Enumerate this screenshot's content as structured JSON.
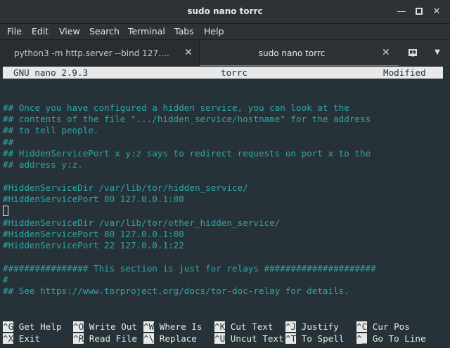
{
  "window": {
    "title": "sudo nano torrc",
    "minimize_icon": "minimize-icon",
    "maximize_icon": "maximize-icon",
    "close_icon": "close-icon"
  },
  "menu": [
    "File",
    "Edit",
    "View",
    "Search",
    "Terminal",
    "Tabs",
    "Help"
  ],
  "tabs": [
    {
      "label": "python3 -m http.server --bind 127.…",
      "active": false
    },
    {
      "label": "sudo nano torrc",
      "active": true
    }
  ],
  "nano": {
    "version": "GNU nano 2.9.3",
    "filename": "torrc",
    "status": "Modified"
  },
  "file_lines": [
    {
      "text": "## Once you have configured a hidden service, you can look at the",
      "type": "comment"
    },
    {
      "text": "## contents of the file \".../hidden_service/hostname\" for the address",
      "type": "comment"
    },
    {
      "text": "## to tell people.",
      "type": "comment"
    },
    {
      "text": "##",
      "type": "comment"
    },
    {
      "text": "## HiddenServicePort x y:z says to redirect requests on port x to the",
      "type": "comment"
    },
    {
      "text": "## address y:z.",
      "type": "comment"
    },
    {
      "text": "",
      "type": "blank"
    },
    {
      "text": "#HiddenServiceDir /var/lib/tor/hidden_service/",
      "type": "comment"
    },
    {
      "text": "#HiddenServicePort 80 127.0.0.1:80",
      "type": "comment"
    },
    {
      "text": "",
      "type": "cursor"
    },
    {
      "text": "#HiddenServiceDir /var/lib/tor/other_hidden_service/",
      "type": "comment"
    },
    {
      "text": "#HiddenServicePort 80 127.0.0.1:80",
      "type": "comment"
    },
    {
      "text": "#HiddenServicePort 22 127.0.0.1:22",
      "type": "comment"
    },
    {
      "text": "",
      "type": "blank"
    },
    {
      "text": "################ This section is just for relays #####################",
      "type": "comment"
    },
    {
      "text": "#",
      "type": "comment"
    },
    {
      "text": "## See https://www.torproject.org/docs/tor-doc-relay for details.",
      "type": "comment"
    }
  ],
  "shortcuts": [
    {
      "key": "^G",
      "label": "Get Help"
    },
    {
      "key": "^O",
      "label": "Write Out"
    },
    {
      "key": "^W",
      "label": "Where Is"
    },
    {
      "key": "^K",
      "label": "Cut Text"
    },
    {
      "key": "^J",
      "label": "Justify"
    },
    {
      "key": "^C",
      "label": "Cur Pos"
    },
    {
      "key": "^X",
      "label": "Exit"
    },
    {
      "key": "^R",
      "label": "Read File"
    },
    {
      "key": "^\\",
      "label": "Replace"
    },
    {
      "key": "^U",
      "label": "Uncut Text"
    },
    {
      "key": "^T",
      "label": "To Spell"
    },
    {
      "key": "^_",
      "label": "Go To Line"
    }
  ],
  "colors": {
    "terminal_bg": "#263238",
    "comment": "#2fa6a6",
    "header_bg": "#e8e8e8",
    "tab_accent": "#4d8fd0"
  }
}
